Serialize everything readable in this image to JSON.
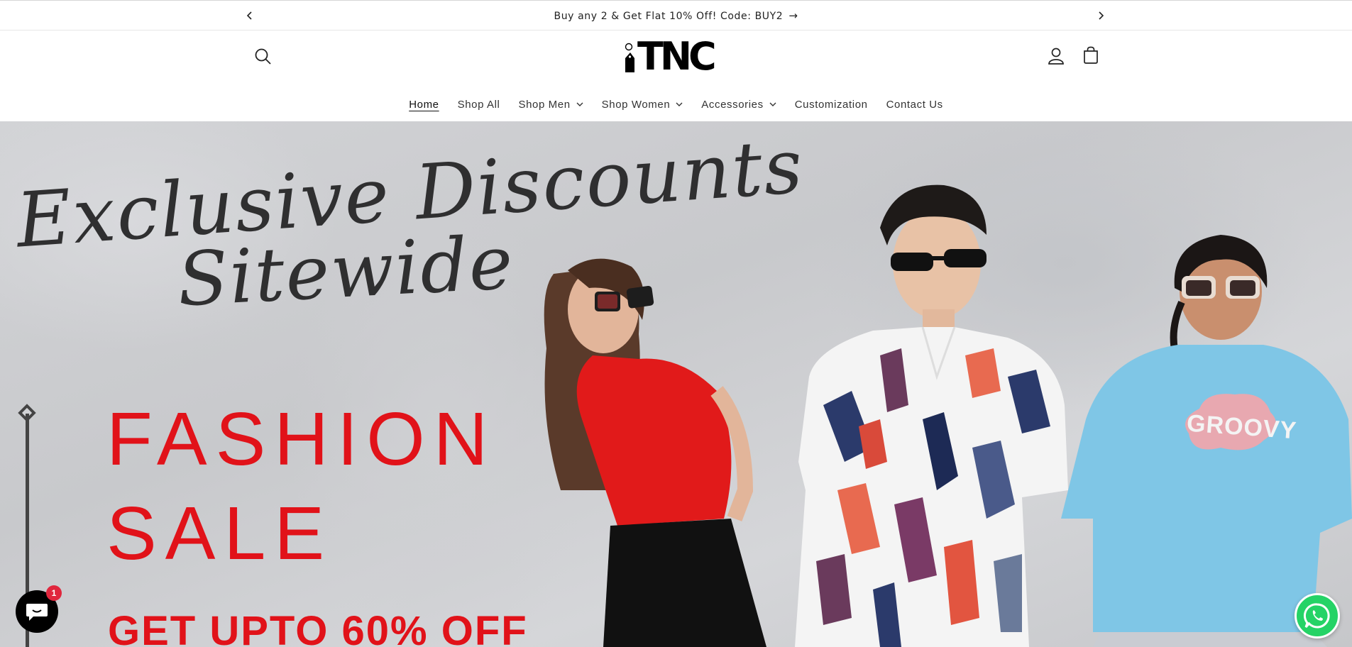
{
  "announcement": {
    "text": "Buy any 2 & Get Flat 10% Off! Code: BUY2",
    "arrow": "→",
    "prev_icon": "chevron-left-icon",
    "next_icon": "chevron-right-icon"
  },
  "header": {
    "logo_text": "TNC",
    "search_icon": "search-icon",
    "account_icon": "account-icon",
    "cart_icon": "cart-icon"
  },
  "nav": {
    "items": [
      {
        "label": "Home",
        "active": true,
        "dropdown": false
      },
      {
        "label": "Shop All",
        "active": false,
        "dropdown": false
      },
      {
        "label": "Shop Men",
        "active": false,
        "dropdown": true
      },
      {
        "label": "Shop Women",
        "active": false,
        "dropdown": true
      },
      {
        "label": "Accessories",
        "active": false,
        "dropdown": true
      },
      {
        "label": "Customization",
        "active": false,
        "dropdown": false
      },
      {
        "label": "Contact Us",
        "active": false,
        "dropdown": false
      }
    ]
  },
  "hero": {
    "script_line1": "Exclusive Discounts",
    "script_line2": "Sitewide",
    "headline1": "FASHION",
    "headline2": "SALE",
    "offer": "GET UPTO 60% OFF",
    "shirt_text": "GROOVY",
    "colors": {
      "sale_red": "#e11219",
      "script": "#2f2f30",
      "background": "#d0d1d4"
    }
  },
  "chat": {
    "badge_count": "1",
    "icon": "chat-bubble-icon"
  },
  "whatsapp": {
    "icon": "whatsapp-icon",
    "color": "#25d366"
  }
}
